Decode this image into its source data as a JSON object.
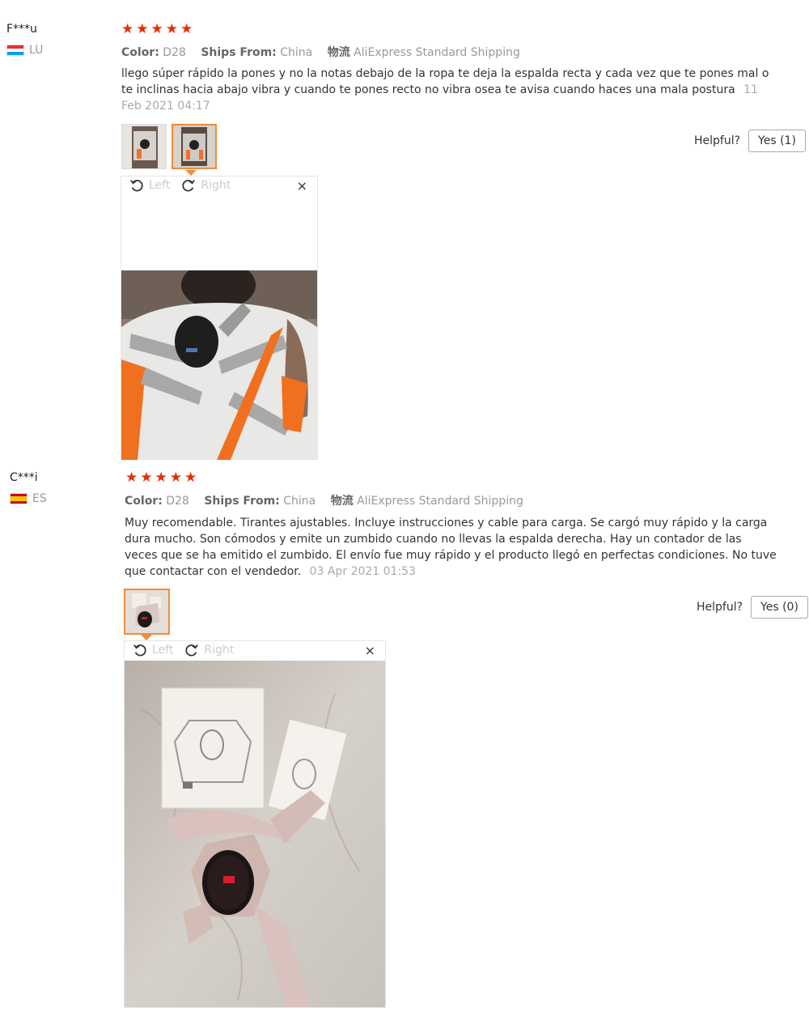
{
  "reviews": [
    {
      "user": "F***u",
      "country_code": "LU",
      "stars": 5,
      "color_label": "Color:",
      "color_value": "D28",
      "ships_label": "Ships From:",
      "ships_value": "China",
      "shipping_icon_text": "物流",
      "shipping_method": "AliExpress Standard Shipping",
      "text": "llego súper rápido la pones y no la notas debajo de la ropa te deja la espalda recta y cada vez que te pones mal o te inclinas hacia abajo vibra y cuando te pones recto no vibra osea te avisa cuando haces una mala postura",
      "date": "11 Feb 2021 04:17",
      "helpful_label": "Helpful?",
      "yes_label": "Yes (1)",
      "rotate_left_label": "Left",
      "rotate_right_label": "Right",
      "close_icon": "×"
    },
    {
      "user": "C***i",
      "country_code": "ES",
      "stars": 5,
      "color_label": "Color:",
      "color_value": "D28",
      "ships_label": "Ships From:",
      "ships_value": "China",
      "shipping_icon_text": "物流",
      "shipping_method": "AliExpress Standard Shipping",
      "text": "Muy recomendable. Tirantes ajustables. Incluye instrucciones y cable para carga. Se cargó muy rápido y la carga dura mucho. Son cómodos y emite un zumbido cuando no llevas la espalda derecha. Hay un contador de las veces que se ha emitido el zumbido. El envío fue muy rápido y el producto llegó en perfectas condiciones. No tuve que contactar con el vendedor.",
      "date": "03 Apr 2021 01:53",
      "helpful_label": "Helpful?",
      "yes_label": "Yes (0)",
      "rotate_left_label": "Left",
      "rotate_right_label": "Right",
      "close_icon": "×"
    }
  ],
  "colors": {
    "star": "#e62e04",
    "accent_border": "#f08c3a",
    "muted": "#999999"
  },
  "icons": {
    "star": "★",
    "rotate_left": "rotate-left-icon",
    "rotate_right": "rotate-right-icon"
  }
}
